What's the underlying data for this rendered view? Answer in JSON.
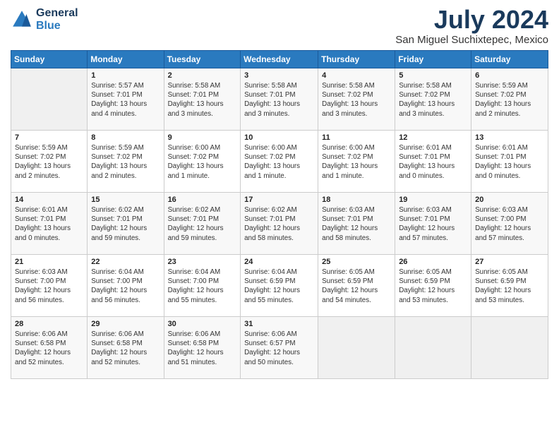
{
  "logo": {
    "line1": "General",
    "line2": "Blue"
  },
  "title": "July 2024",
  "subtitle": "San Miguel Suchixtepec, Mexico",
  "days_of_week": [
    "Sunday",
    "Monday",
    "Tuesday",
    "Wednesday",
    "Thursday",
    "Friday",
    "Saturday"
  ],
  "weeks": [
    [
      {
        "day": "",
        "info": ""
      },
      {
        "day": "1",
        "info": "Sunrise: 5:57 AM\nSunset: 7:01 PM\nDaylight: 13 hours\nand 4 minutes."
      },
      {
        "day": "2",
        "info": "Sunrise: 5:58 AM\nSunset: 7:01 PM\nDaylight: 13 hours\nand 3 minutes."
      },
      {
        "day": "3",
        "info": "Sunrise: 5:58 AM\nSunset: 7:01 PM\nDaylight: 13 hours\nand 3 minutes."
      },
      {
        "day": "4",
        "info": "Sunrise: 5:58 AM\nSunset: 7:02 PM\nDaylight: 13 hours\nand 3 minutes."
      },
      {
        "day": "5",
        "info": "Sunrise: 5:58 AM\nSunset: 7:02 PM\nDaylight: 13 hours\nand 3 minutes."
      },
      {
        "day": "6",
        "info": "Sunrise: 5:59 AM\nSunset: 7:02 PM\nDaylight: 13 hours\nand 2 minutes."
      }
    ],
    [
      {
        "day": "7",
        "info": "Sunrise: 5:59 AM\nSunset: 7:02 PM\nDaylight: 13 hours\nand 2 minutes."
      },
      {
        "day": "8",
        "info": "Sunrise: 5:59 AM\nSunset: 7:02 PM\nDaylight: 13 hours\nand 2 minutes."
      },
      {
        "day": "9",
        "info": "Sunrise: 6:00 AM\nSunset: 7:02 PM\nDaylight: 13 hours\nand 1 minute."
      },
      {
        "day": "10",
        "info": "Sunrise: 6:00 AM\nSunset: 7:02 PM\nDaylight: 13 hours\nand 1 minute."
      },
      {
        "day": "11",
        "info": "Sunrise: 6:00 AM\nSunset: 7:02 PM\nDaylight: 13 hours\nand 1 minute."
      },
      {
        "day": "12",
        "info": "Sunrise: 6:01 AM\nSunset: 7:01 PM\nDaylight: 13 hours\nand 0 minutes."
      },
      {
        "day": "13",
        "info": "Sunrise: 6:01 AM\nSunset: 7:01 PM\nDaylight: 13 hours\nand 0 minutes."
      }
    ],
    [
      {
        "day": "14",
        "info": "Sunrise: 6:01 AM\nSunset: 7:01 PM\nDaylight: 13 hours\nand 0 minutes."
      },
      {
        "day": "15",
        "info": "Sunrise: 6:02 AM\nSunset: 7:01 PM\nDaylight: 12 hours\nand 59 minutes."
      },
      {
        "day": "16",
        "info": "Sunrise: 6:02 AM\nSunset: 7:01 PM\nDaylight: 12 hours\nand 59 minutes."
      },
      {
        "day": "17",
        "info": "Sunrise: 6:02 AM\nSunset: 7:01 PM\nDaylight: 12 hours\nand 58 minutes."
      },
      {
        "day": "18",
        "info": "Sunrise: 6:03 AM\nSunset: 7:01 PM\nDaylight: 12 hours\nand 58 minutes."
      },
      {
        "day": "19",
        "info": "Sunrise: 6:03 AM\nSunset: 7:01 PM\nDaylight: 12 hours\nand 57 minutes."
      },
      {
        "day": "20",
        "info": "Sunrise: 6:03 AM\nSunset: 7:00 PM\nDaylight: 12 hours\nand 57 minutes."
      }
    ],
    [
      {
        "day": "21",
        "info": "Sunrise: 6:03 AM\nSunset: 7:00 PM\nDaylight: 12 hours\nand 56 minutes."
      },
      {
        "day": "22",
        "info": "Sunrise: 6:04 AM\nSunset: 7:00 PM\nDaylight: 12 hours\nand 56 minutes."
      },
      {
        "day": "23",
        "info": "Sunrise: 6:04 AM\nSunset: 7:00 PM\nDaylight: 12 hours\nand 55 minutes."
      },
      {
        "day": "24",
        "info": "Sunrise: 6:04 AM\nSunset: 6:59 PM\nDaylight: 12 hours\nand 55 minutes."
      },
      {
        "day": "25",
        "info": "Sunrise: 6:05 AM\nSunset: 6:59 PM\nDaylight: 12 hours\nand 54 minutes."
      },
      {
        "day": "26",
        "info": "Sunrise: 6:05 AM\nSunset: 6:59 PM\nDaylight: 12 hours\nand 53 minutes."
      },
      {
        "day": "27",
        "info": "Sunrise: 6:05 AM\nSunset: 6:59 PM\nDaylight: 12 hours\nand 53 minutes."
      }
    ],
    [
      {
        "day": "28",
        "info": "Sunrise: 6:06 AM\nSunset: 6:58 PM\nDaylight: 12 hours\nand 52 minutes."
      },
      {
        "day": "29",
        "info": "Sunrise: 6:06 AM\nSunset: 6:58 PM\nDaylight: 12 hours\nand 52 minutes."
      },
      {
        "day": "30",
        "info": "Sunrise: 6:06 AM\nSunset: 6:58 PM\nDaylight: 12 hours\nand 51 minutes."
      },
      {
        "day": "31",
        "info": "Sunrise: 6:06 AM\nSunset: 6:57 PM\nDaylight: 12 hours\nand 50 minutes."
      },
      {
        "day": "",
        "info": ""
      },
      {
        "day": "",
        "info": ""
      },
      {
        "day": "",
        "info": ""
      }
    ]
  ]
}
